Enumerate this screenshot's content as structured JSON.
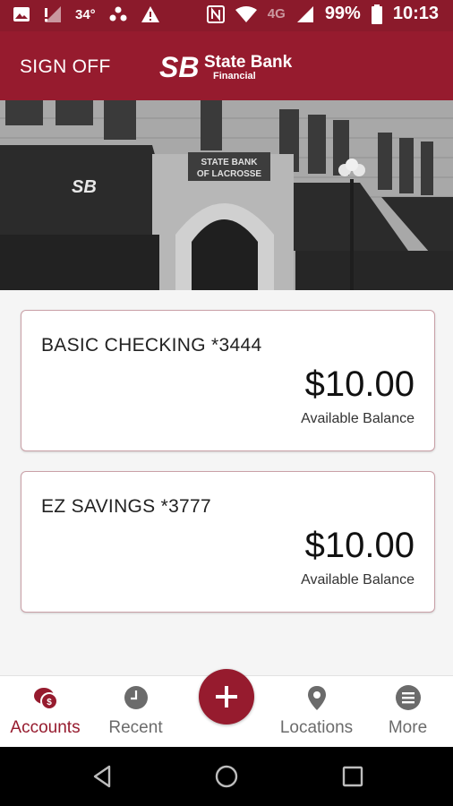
{
  "status_bar": {
    "temperature": "34°",
    "battery_percent": "99%",
    "time": "10:13",
    "network": "4G",
    "icons": [
      "image-icon",
      "signal-alert-icon",
      "weather-icon",
      "warning-icon",
      "nfc-icon",
      "wifi-icon",
      "cell-signal-icon",
      "battery-icon"
    ]
  },
  "header": {
    "sign_off": "SIGN OFF",
    "logo_mark": "SB",
    "logo_name": "State Bank",
    "logo_sub": "Financial"
  },
  "hero": {
    "building_sign": [
      "STATE BANK",
      "OF LACROSSE"
    ],
    "awning_text": "SB"
  },
  "accounts": [
    {
      "name": "BASIC CHECKING *3444",
      "amount": "$10.00",
      "label": "Available Balance"
    },
    {
      "name": "EZ SAVINGS *3777",
      "amount": "$10.00",
      "label": "Available Balance"
    }
  ],
  "tabs": [
    {
      "label": "Accounts",
      "icon": "accounts-icon",
      "active": true
    },
    {
      "label": "Recent",
      "icon": "clock-icon",
      "active": false
    },
    {
      "label": "Locations",
      "icon": "map-pin-icon",
      "active": false
    },
    {
      "label": "More",
      "icon": "menu-icon",
      "active": false
    }
  ],
  "fab": {
    "icon": "plus-icon"
  },
  "colors": {
    "brand": "#961b2e",
    "inactive": "#6b6b6b"
  }
}
